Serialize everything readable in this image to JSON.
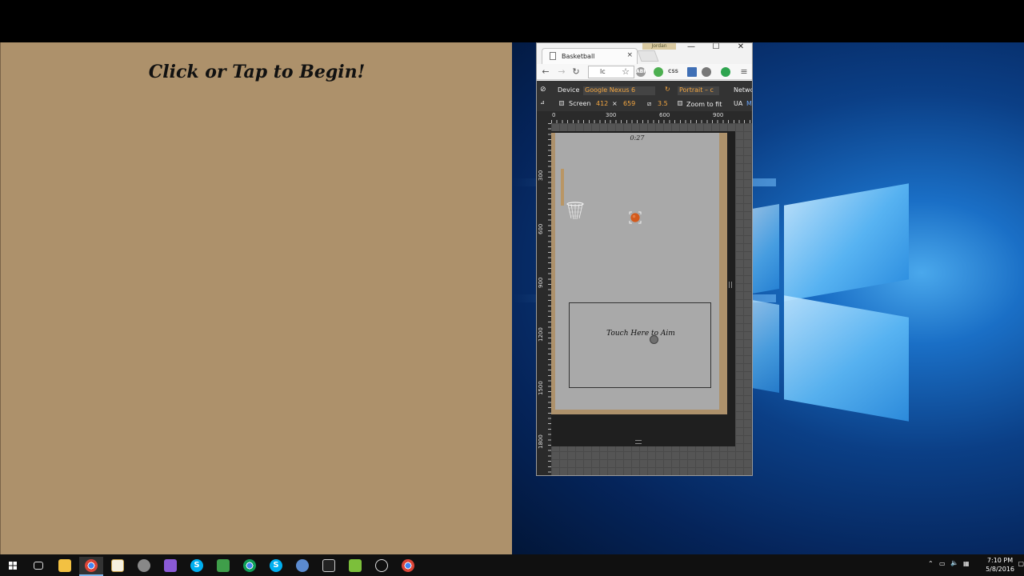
{
  "left_app": {
    "prompt": "Click or Tap to Begin!",
    "background": "#ad916b"
  },
  "browser": {
    "tab_title": "Basketball",
    "tab_close": "×",
    "profile_label": "Jordan",
    "window_controls": {
      "minimize": "—",
      "maximize": "☐",
      "close": "✕"
    },
    "toolbar": {
      "back": "←",
      "forward": "→",
      "reload": "↻",
      "address": "lc",
      "star": "☆",
      "extensions": [
        "ABP",
        "CSS"
      ]
    },
    "devtools": {
      "device_label": "Device",
      "device_value": "Google Nexus 6",
      "orientation_value": "Portrait – c",
      "network_label": "Netwo",
      "screen_label": "Screen",
      "screen_width": "412",
      "times": "×",
      "screen_height": "659",
      "dpr": "3.5",
      "zoom_label": "Zoom to fit",
      "ua_label": "UA",
      "ua_value": "M"
    },
    "ruler_h": [
      "0",
      "300",
      "600",
      "900"
    ],
    "ruler_v": [
      "300",
      "600",
      "900",
      "1200",
      "1500",
      "1800"
    ]
  },
  "game": {
    "timer": "0:27",
    "aim_label": "Touch Here to Aim",
    "colors": {
      "wood": "#ad916b",
      "court": "#a9a9a9",
      "ball": "#d35a1c"
    }
  },
  "taskbar": {
    "icons": [
      "start-icon",
      "task-view-icon",
      "file-explorer-icon",
      "chrome-icon",
      "document-icon",
      "game-icon",
      "app-icon",
      "skype-icon",
      "tool-icon",
      "chrome-icon",
      "skype-icon",
      "globe-icon",
      "window-icon",
      "notepad-icon",
      "media-icon",
      "chrome-icon"
    ],
    "clock_time": "7:10 PM",
    "clock_date": "5/8/2016"
  }
}
